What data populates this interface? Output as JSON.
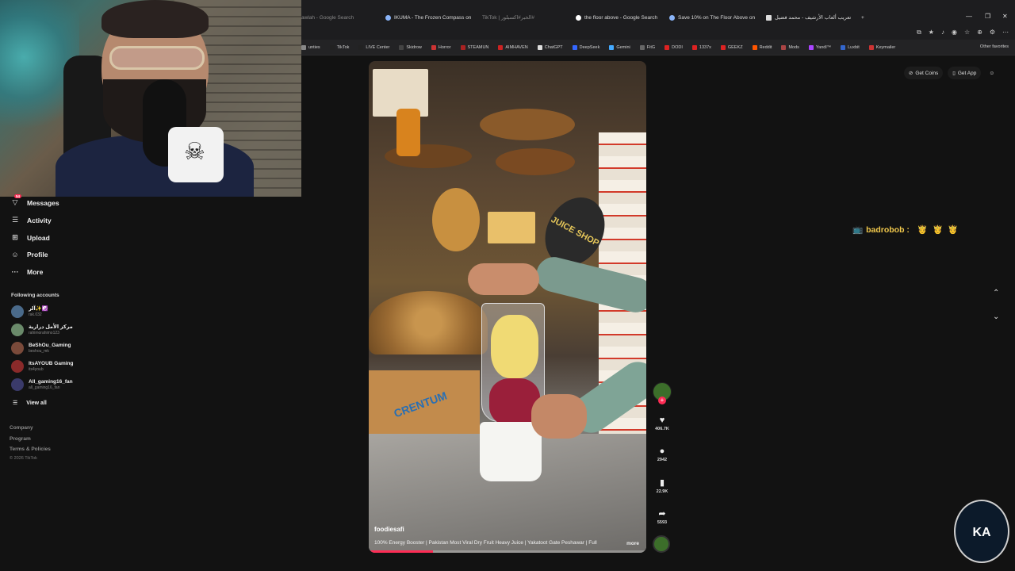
{
  "browser": {
    "tabs": [
      {
        "title": "awlah - Google Search",
        "dim": true
      },
      {
        "title": "IKUMA - The Frozen Compass on",
        "dim": false
      },
      {
        "title": "TikTok | الخبر#اكسبلور#",
        "dim": true
      },
      {
        "title": "the floor above - Google Search",
        "dim": false
      },
      {
        "title": "Save 10% on The Floor Above on",
        "dim": false
      },
      {
        "title": "تعريب ألعاب الأرشيف - محمد فضيل",
        "dim": false
      }
    ],
    "window_controls": [
      "—",
      "❐",
      "✕"
    ],
    "new_tab": "+",
    "bookmarks": [
      {
        "label": "unties",
        "color": "#888"
      },
      {
        "label": "TikTok",
        "color": "#222"
      },
      {
        "label": "LIVE Center",
        "color": "#222"
      },
      {
        "label": "Skidrow",
        "color": "#444"
      },
      {
        "label": "Horror",
        "color": "#c33"
      },
      {
        "label": "STEAMUN",
        "color": "#a22"
      },
      {
        "label": "AIMHAVEN",
        "color": "#c22"
      },
      {
        "label": "ChatGPT",
        "color": "#ddd"
      },
      {
        "label": "DeepSeek",
        "color": "#36f"
      },
      {
        "label": "Gemini",
        "color": "#4af"
      },
      {
        "label": "FitG",
        "color": "#666"
      },
      {
        "label": "DODI",
        "color": "#d22"
      },
      {
        "label": "1337x",
        "color": "#d22"
      },
      {
        "label": "GEEKZ",
        "color": "#d22"
      },
      {
        "label": "Reddit",
        "color": "#f50"
      },
      {
        "label": "Mods",
        "color": "#a44"
      },
      {
        "label": "Yandl™",
        "color": "#a4f"
      },
      {
        "label": "Luxbit",
        "color": "#36c"
      },
      {
        "label": "Keymailer",
        "color": "#c33"
      }
    ],
    "other_favorites": "Other favorites"
  },
  "sidebar": {
    "items": [
      {
        "label": "Messages",
        "icon": "messages-icon",
        "glyph": "▽",
        "badge": "54"
      },
      {
        "label": "Activity",
        "icon": "activity-icon",
        "glyph": "☰",
        "badge": ""
      },
      {
        "label": "Upload",
        "icon": "upload-icon",
        "glyph": "⊞",
        "badge": ""
      },
      {
        "label": "Profile",
        "icon": "profile-icon",
        "glyph": "☺",
        "badge": ""
      },
      {
        "label": "More",
        "icon": "more-icon",
        "glyph": "···",
        "badge": ""
      }
    ],
    "following_title": "Following accounts",
    "accounts": [
      {
        "name": "آلر✨☯️",
        "handle": "rak.032",
        "color": "#4a6a8a"
      },
      {
        "name": "مركز الأمل درارية",
        "handle": "rahimorahimo123",
        "color": "#6a8a6a"
      },
      {
        "name": "BeShOu_Gaming",
        "handle": "beshou_mk",
        "color": "#7a4a3a"
      },
      {
        "name": "ItsAYOUB Gaming",
        "handle": "its4youb",
        "color": "#8a2a2a"
      },
      {
        "name": "All_gaming16_fan",
        "handle": "all_gaming16_fan",
        "color": "#3a3a6a"
      }
    ],
    "view_all": "View all",
    "footer_links": [
      "Company",
      "Program",
      "Terms & Policies"
    ],
    "copyright": "© 2026 TikTok"
  },
  "top_actions": {
    "get_coins": "Get Coins",
    "get_app": "Get App"
  },
  "video": {
    "author": "foodiesafi",
    "description": "100% Energy Booster | Pakistan Most Viral Dry Fruit Heavy Juice | Yakatoot Gate Peshawar | Full",
    "more": "more",
    "sign_text": "JUICE SHOP",
    "carton_text": "CRENTUM",
    "progress": 0.23
  },
  "actions": {
    "likes": "406.7K",
    "comments": "2942",
    "saves": "22.9K",
    "shares": "5593"
  },
  "chat": {
    "user": "badrobob :",
    "emotes": "🤴🤴🤴",
    "icon": "📺"
  },
  "nav": {
    "up": "⌃",
    "down": "⌄"
  },
  "logo": {
    "text": "KA"
  }
}
